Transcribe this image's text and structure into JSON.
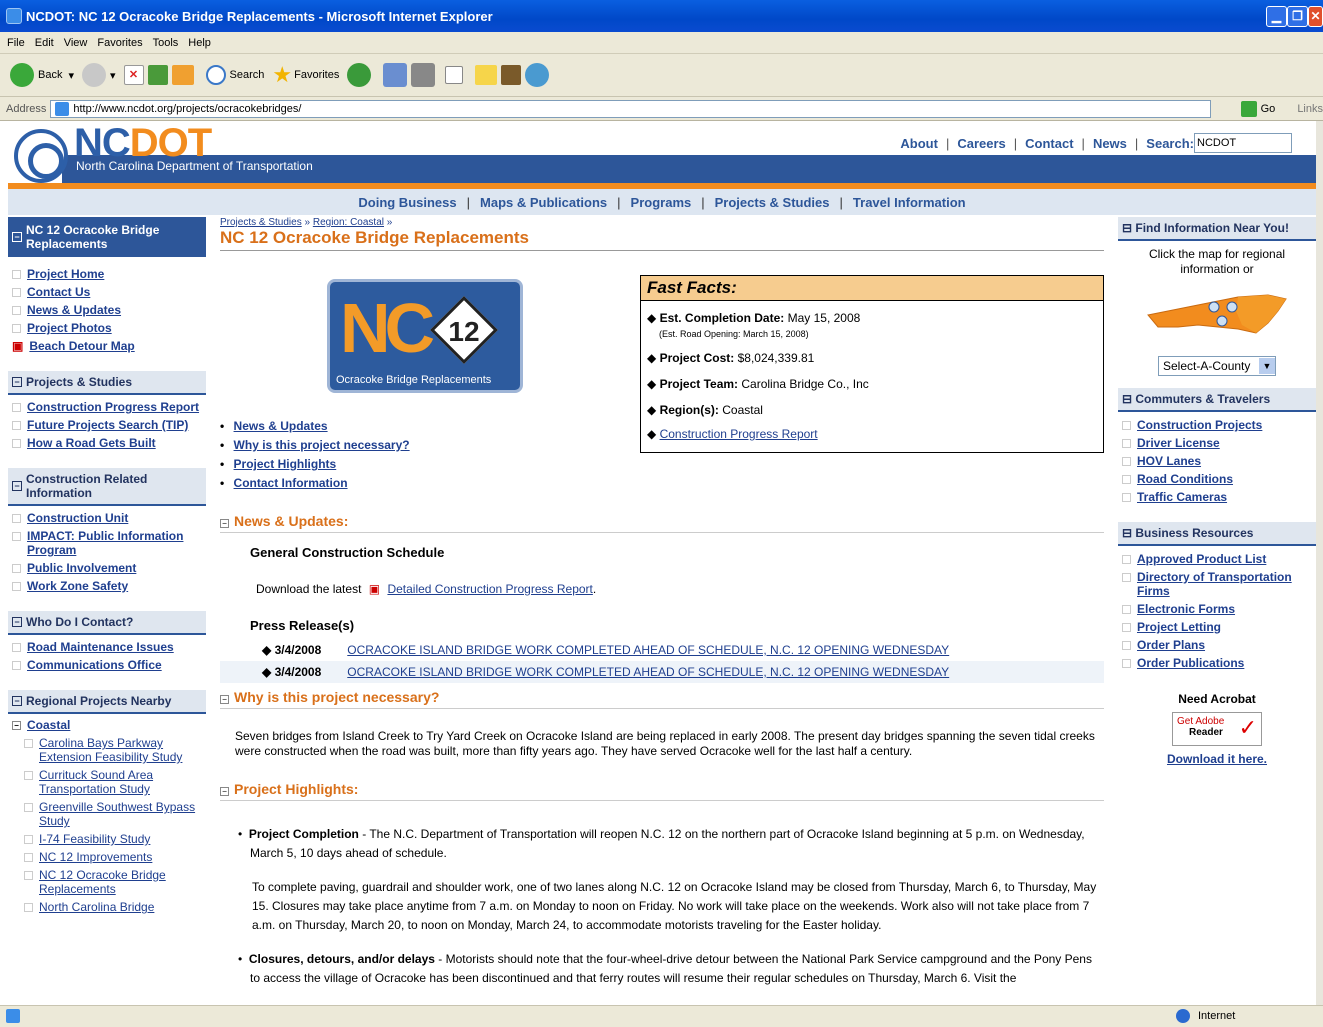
{
  "window": {
    "title": "NCDOT: NC 12 Ocracoke Bridge Replacements - Microsoft Internet Explorer"
  },
  "menu": [
    "File",
    "Edit",
    "View",
    "Favorites",
    "Tools",
    "Help"
  ],
  "toolbar": {
    "back": "Back",
    "search": "Search",
    "favorites": "Favorites"
  },
  "address": {
    "label": "Address",
    "url": "http://www.ncdot.org/projects/ocracokebridges/",
    "go": "Go",
    "links": "Links"
  },
  "site": {
    "logo_nc": "NC",
    "logo_dot": "DOT",
    "dept": "North Carolina Department of Transportation",
    "toplinks": [
      "About",
      "Careers",
      "Contact",
      "News"
    ],
    "search_label": "Search:",
    "search_value": "NCDOT",
    "nav": [
      "Doing Business",
      "Maps & Publications",
      "Programs",
      "Projects & Studies",
      "Travel Information"
    ]
  },
  "left": {
    "project_title": "NC 12 Ocracoke Bridge Replacements",
    "project_links": [
      "Project Home",
      "Contact Us",
      "News & Updates",
      "Project Photos",
      "Beach Detour Map"
    ],
    "s1": {
      "title": "Projects & Studies",
      "items": [
        "Construction Progress Report",
        "Future Projects Search (TIP)",
        "How a Road Gets Built"
      ]
    },
    "s2": {
      "title": "Construction Related Information",
      "items": [
        "Construction Unit",
        "IMPACT: Public Information Program",
        "Public Involvement",
        "Work Zone Safety"
      ]
    },
    "s3": {
      "title": "Who Do I Contact?",
      "items": [
        "Road Maintenance Issues",
        "Communications Office"
      ]
    },
    "s4": {
      "title": "Regional Projects Nearby",
      "region": "Coastal",
      "items": [
        "Carolina Bays Parkway Extension Feasibility Study",
        "Currituck Sound Area Transportation Study",
        "Greenville Southwest Bypass Study",
        "I-74 Feasibility Study",
        "NC 12 Improvements",
        "NC 12 Ocracoke Bridge Replacements",
        "North Carolina Bridge"
      ]
    }
  },
  "main": {
    "crumb1": "Projects & Studies",
    "crumb_sep": "»",
    "crumb2": "Region: Coastal",
    "crumb_end": "»",
    "title": "NC 12 Ocracoke Bridge Replacements",
    "logo": {
      "nc": "NC",
      "num": "12",
      "sub": "Ocracoke Bridge Replacements"
    },
    "facts": {
      "title": "Fast Facts:",
      "completion_label": "Est. Completion Date:",
      "completion_value": "May 15, 2008",
      "road_opening": "(Est. Road Opening: March 15, 2008)",
      "cost_label": "Project Cost:",
      "cost_value": "$8,024,339.81",
      "team_label": "Project Team:",
      "team_value": "Carolina Bridge Co., Inc",
      "region_label": "Region(s):",
      "region_value": "Coastal",
      "report_link": "Construction Progress Report"
    },
    "toc": [
      "News & Updates",
      "Why is this project necessary?",
      "Project Highlights",
      "Contact Information"
    ],
    "news": {
      "heading": "News & Updates:",
      "schedule_title": "General Construction Schedule",
      "download_prefix": "Download the latest",
      "download_link": "Detailed Construction Progress Report",
      "download_suffix": ".",
      "press_title": "Press Release(s)",
      "press": [
        {
          "date": "3/4/2008",
          "title": "OCRACOKE ISLAND BRIDGE WORK COMPLETED AHEAD OF SCHEDULE, N.C. 12 OPENING WEDNESDAY"
        },
        {
          "date": "3/4/2008",
          "title": "OCRACOKE ISLAND BRIDGE WORK COMPLETED AHEAD OF SCHEDULE, N.C. 12 OPENING WEDNESDAY"
        }
      ]
    },
    "why": {
      "heading": "Why is this project necessary?",
      "text": "Seven bridges from Island Creek to Try Yard Creek on Ocracoke Island are being replaced in early 2008. The present day bridges spanning the seven tidal creeks were constructed when the road was built, more than fifty years ago. They have served Ocracoke well for the last half a century."
    },
    "highlights": {
      "heading": "Project Highlights:",
      "h1_label": "Project Completion",
      "h1_text": " - The N.C. Department of Transportation will reopen N.C. 12 on the northern part of Ocracoke Island beginning at 5 p.m. on Wednesday, March 5, 10 days ahead of schedule.",
      "h1_para2": "To complete paving, guardrail and shoulder work, one of two lanes along N.C. 12 on Ocracoke Island may be closed from Thursday, March 6, to Thursday, May 15. Closures may take place anytime from 7 a.m. on Monday to noon on Friday. No work will take place on the weekends. Work also will not take place from 7 a.m. on Thursday, March 20, to noon on Monday, March 24, to accommodate motorists traveling for the Easter holiday.",
      "h2_label": "Closures, detours, and/or delays",
      "h2_text": " - Motorists should note that the four-wheel-drive detour between the National Park Service campground and the Pony Pens to access the village of Ocracoke has been discontinued and that ferry routes will resume their regular schedules on Thursday, March 6. Visit the"
    }
  },
  "right": {
    "find_title": "Find Information Near You!",
    "find_text": "Click the map for regional information or",
    "county_select": "Select-A-County",
    "commuters": {
      "title": "Commuters & Travelers",
      "items": [
        "Construction Projects",
        "Driver License",
        "HOV Lanes",
        "Road Conditions",
        "Traffic Cameras"
      ]
    },
    "business": {
      "title": "Business Resources",
      "items": [
        "Approved Product List",
        "Directory of Transportation Firms",
        "Electronic Forms",
        "Project Letting",
        "Order Plans",
        "Order Publications"
      ]
    },
    "acrobat_title": "Need Acrobat",
    "acrobat_badge_get": "Get Adobe",
    "acrobat_badge_reader": "Reader",
    "acrobat_link": "Download it here."
  },
  "status": {
    "zone": "Internet"
  },
  "colors": {
    "brand_blue": "#2d5699",
    "brand_orange": "#f28c1e",
    "facts_bg": "#f6cc8f"
  }
}
